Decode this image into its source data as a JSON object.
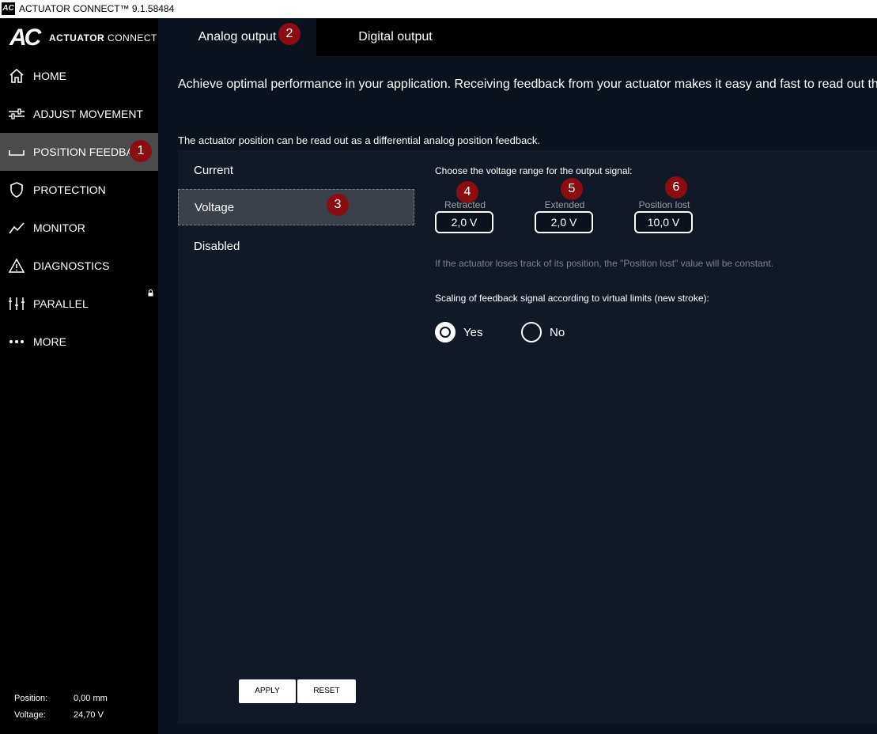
{
  "window": {
    "title": "ACTUATOR CONNECT™ 9.1.58484",
    "icon_text": "AC"
  },
  "sidebar": {
    "logo_mark": "AC",
    "logo_word_bold": "ACTUATOR",
    "logo_word_light": " CONNECT",
    "items": [
      {
        "label": "HOME",
        "icon": "home-icon"
      },
      {
        "label": "ADJUST MOVEMENT",
        "icon": "sliders-icon"
      },
      {
        "label": "POSITION FEEDBACK",
        "icon": "position-feedback-icon"
      },
      {
        "label": "PROTECTION",
        "icon": "shield-icon"
      },
      {
        "label": "MONITOR",
        "icon": "chart-line-icon"
      },
      {
        "label": "DIAGNOSTICS",
        "icon": "warning-icon"
      },
      {
        "label": "PARALLEL",
        "icon": "parallel-icon"
      },
      {
        "label": "MORE",
        "icon": "more-dots-icon"
      }
    ],
    "status": [
      {
        "key": "Position:",
        "value": "0,00 mm"
      },
      {
        "key": "Voltage:",
        "value": "24,70 V"
      }
    ]
  },
  "tabs": [
    {
      "label": "Analog output"
    },
    {
      "label": "Digital output"
    }
  ],
  "badges": [
    "1",
    "2",
    "3",
    "4",
    "5",
    "6"
  ],
  "main": {
    "intro": "Achieve optimal performance in your application. Receiving feedback from your actuator makes it easy and fast to read out th",
    "sub": "The actuator position can be read out as a differential analog position feedback.",
    "options": [
      {
        "label": "Current"
      },
      {
        "label": "Voltage"
      },
      {
        "label": "Disabled"
      }
    ],
    "voltage_heading": "Choose the voltage range for the output signal:",
    "fields": [
      {
        "label": "Retracted",
        "value": "2,0 V"
      },
      {
        "label": "Extended",
        "value": "2,0 V"
      },
      {
        "label": "Position lost",
        "value": "10,0 V"
      }
    ],
    "note": "If the actuator loses track of its position, the \"Position lost\" value will be constant.",
    "scaling_heading": "Scaling of feedback signal according to virtual limits (new stroke):",
    "radios": [
      {
        "label": "Yes",
        "selected": true
      },
      {
        "label": "No",
        "selected": false
      }
    ],
    "apply_label": "APPLY",
    "reset_label": "RESET"
  }
}
